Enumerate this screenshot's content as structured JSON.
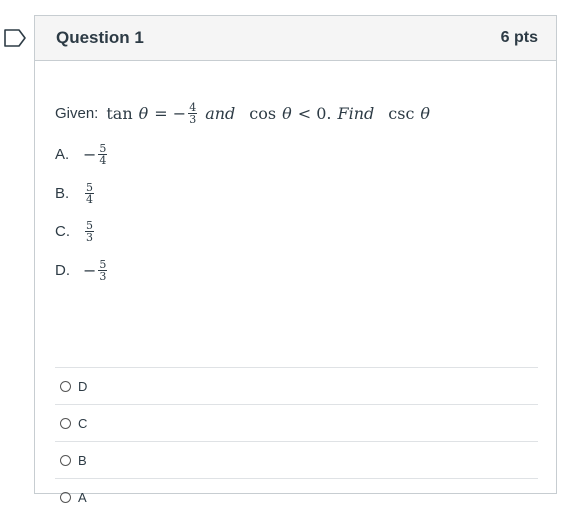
{
  "question": {
    "title": "Question 1",
    "points": "6 pts"
  },
  "stem": {
    "prefix": "Given:",
    "tan_fn": "tan",
    "theta": "θ",
    "equals": "= −",
    "frac_num": "4",
    "frac_den": "3",
    "and": "and",
    "cos_fn": "cos",
    "lt": "< 0.",
    "find": "Find",
    "csc_fn": "csc"
  },
  "choices": [
    {
      "letter": "A.",
      "sign": "−",
      "num": "5",
      "den": "4"
    },
    {
      "letter": "B.",
      "sign": "",
      "num": "5",
      "den": "4"
    },
    {
      "letter": "C.",
      "sign": "",
      "num": "5",
      "den": "3"
    },
    {
      "letter": "D.",
      "sign": "−",
      "num": "5",
      "den": "3"
    }
  ],
  "answers": [
    {
      "label": "D"
    },
    {
      "label": "C"
    },
    {
      "label": "B"
    },
    {
      "label": "A"
    }
  ],
  "colors": {
    "text": "#2d3b45",
    "header_bg": "#f5f5f5",
    "border": "#c7cdd1",
    "bookmark": "#2d3b45"
  },
  "icons": {
    "bookmark": "bookmark-flag-icon",
    "radio": "radio-button"
  }
}
